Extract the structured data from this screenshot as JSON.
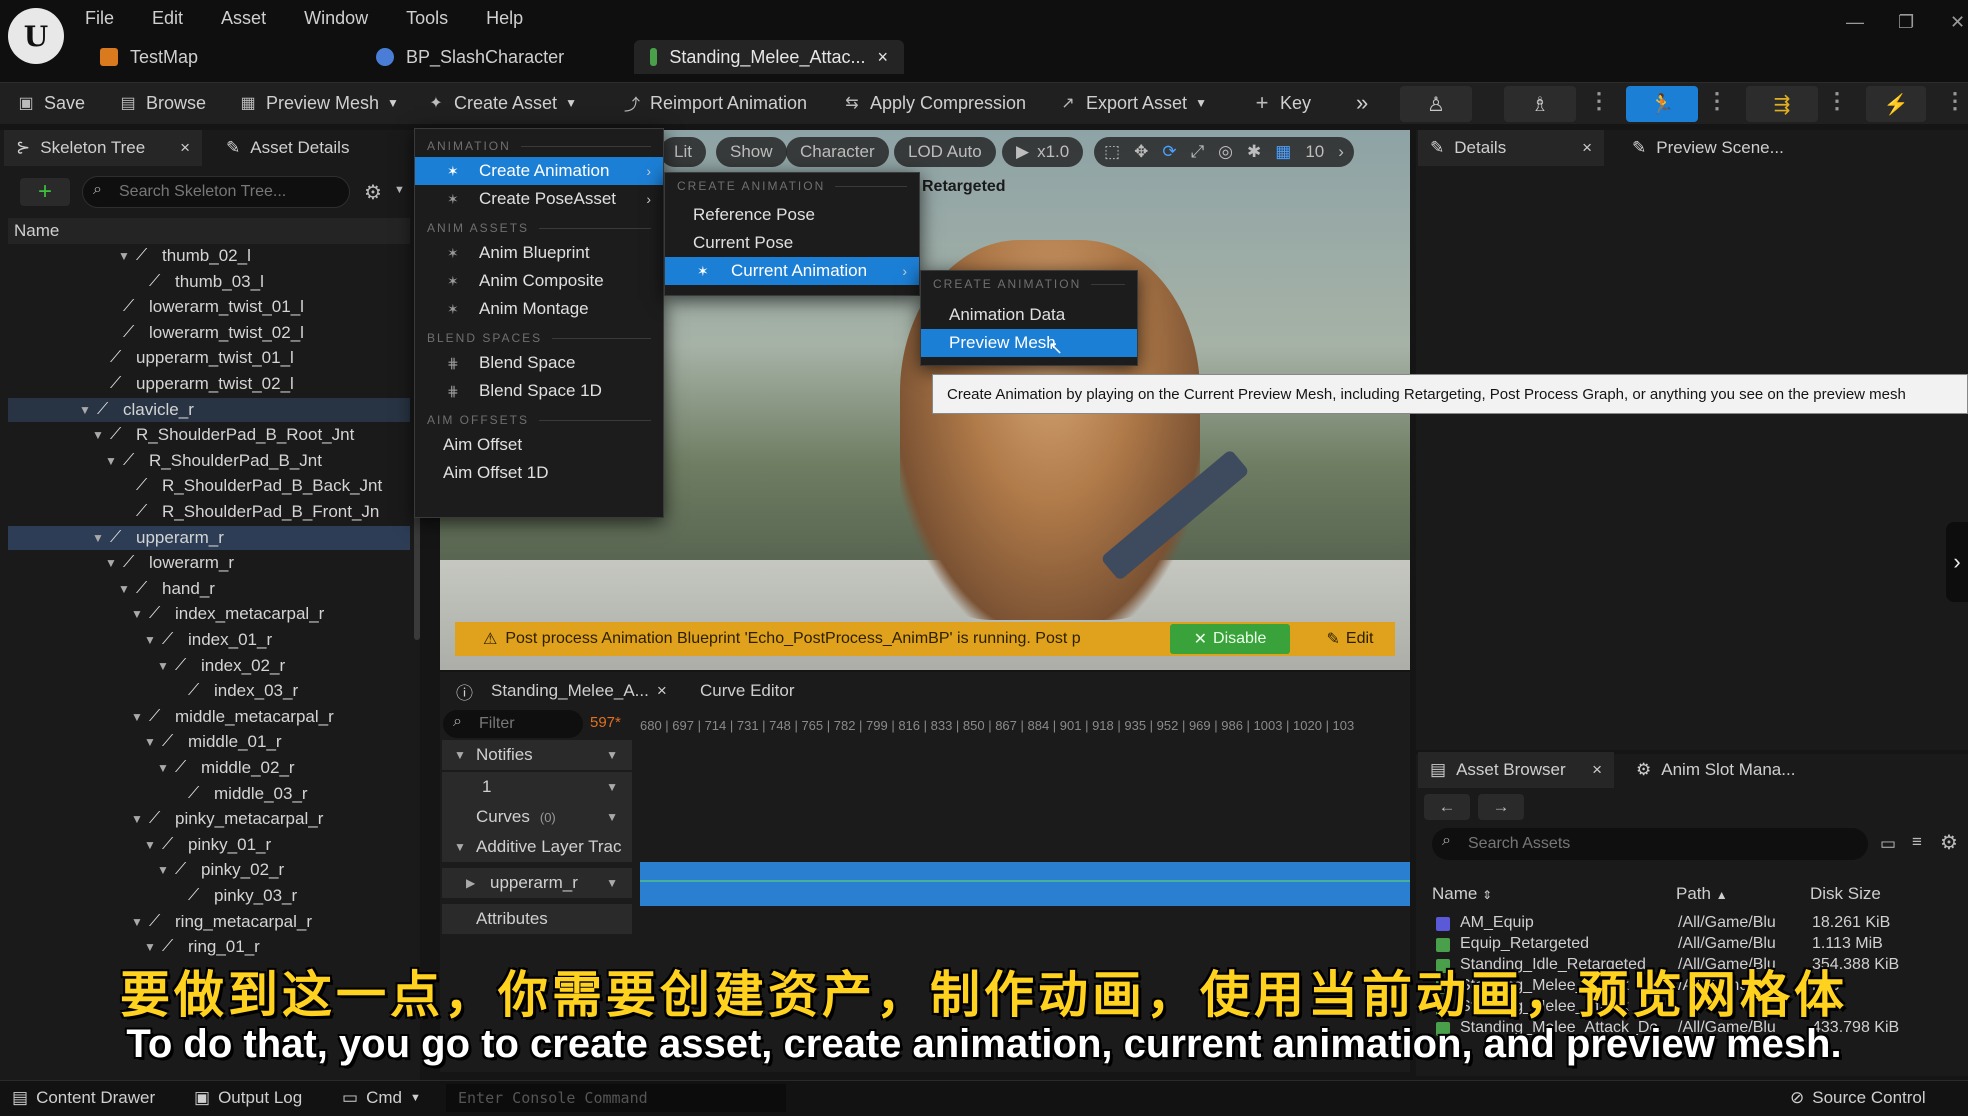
{
  "menubar": [
    "File",
    "Edit",
    "Asset",
    "Window",
    "Tools",
    "Help"
  ],
  "doc_tabs": [
    {
      "label": "TestMap"
    },
    {
      "label": "BP_SlashCharacter"
    },
    {
      "label": "Standing_Melee_Attac...",
      "close": "×"
    }
  ],
  "toolbar": {
    "save": "Save",
    "browse": "Browse",
    "preview_mesh": "Preview Mesh",
    "create_asset": "Create Asset",
    "reimport": "Reimport Animation",
    "apply_compression": "Apply Compression",
    "export_asset": "Export Asset",
    "key": "Key"
  },
  "left_panel": {
    "tabs": [
      "Skeleton Tree",
      "Asset Details"
    ],
    "search_placeholder": "Search Skeleton Tree...",
    "name_header": "Name",
    "bones": [
      {
        "label": "thumb_02_l",
        "depth": 6,
        "twist": "▼"
      },
      {
        "label": "thumb_03_l",
        "depth": 7,
        "twist": ""
      },
      {
        "label": "lowerarm_twist_01_l",
        "depth": 5,
        "twist": ""
      },
      {
        "label": "lowerarm_twist_02_l",
        "depth": 5,
        "twist": ""
      },
      {
        "label": "upperarm_twist_01_l",
        "depth": 4,
        "twist": ""
      },
      {
        "label": "upperarm_twist_02_l",
        "depth": 4,
        "twist": ""
      },
      {
        "label": "clavicle_r",
        "depth": 3,
        "twist": "▼",
        "state": "hover"
      },
      {
        "label": "R_ShoulderPad_B_Root_Jnt",
        "depth": 4,
        "twist": "▼"
      },
      {
        "label": "R_ShoulderPad_B_Jnt",
        "depth": 5,
        "twist": "▼"
      },
      {
        "label": "R_ShoulderPad_B_Back_Jnt",
        "depth": 6,
        "twist": ""
      },
      {
        "label": "R_ShoulderPad_B_Front_Jn",
        "depth": 6,
        "twist": ""
      },
      {
        "label": "upperarm_r",
        "depth": 4,
        "twist": "▼",
        "state": "selected"
      },
      {
        "label": "lowerarm_r",
        "depth": 5,
        "twist": "▼"
      },
      {
        "label": "hand_r",
        "depth": 6,
        "twist": "▼"
      },
      {
        "label": "index_metacarpal_r",
        "depth": 7,
        "twist": "▼"
      },
      {
        "label": "index_01_r",
        "depth": 8,
        "twist": "▼"
      },
      {
        "label": "index_02_r",
        "depth": 9,
        "twist": "▼"
      },
      {
        "label": "index_03_r",
        "depth": 10,
        "twist": ""
      },
      {
        "label": "middle_metacarpal_r",
        "depth": 7,
        "twist": "▼"
      },
      {
        "label": "middle_01_r",
        "depth": 8,
        "twist": "▼"
      },
      {
        "label": "middle_02_r",
        "depth": 9,
        "twist": "▼"
      },
      {
        "label": "middle_03_r",
        "depth": 10,
        "twist": ""
      },
      {
        "label": "pinky_metacarpal_r",
        "depth": 7,
        "twist": "▼"
      },
      {
        "label": "pinky_01_r",
        "depth": 8,
        "twist": "▼"
      },
      {
        "label": "pinky_02_r",
        "depth": 9,
        "twist": "▼"
      },
      {
        "label": "pinky_03_r",
        "depth": 10,
        "twist": ""
      },
      {
        "label": "ring_metacarpal_r",
        "depth": 7,
        "twist": "▼"
      },
      {
        "label": "ring_01_r",
        "depth": 8,
        "twist": "▼"
      }
    ]
  },
  "viewport": {
    "lit": "Lit",
    "show": "Show",
    "character": "Character",
    "lod": "LOD Auto",
    "speed": "x1.0",
    "grid_value": "10",
    "retargeted_label": "Retargeted",
    "warning": "Post process Animation Blueprint 'Echo_PostProcess_AnimBP' is running. Post p",
    "disable": "Disable",
    "edit": "Edit"
  },
  "create_asset_menu": {
    "sections": {
      "animation": "ANIMATION",
      "anim_assets": "ANIM ASSETS",
      "blend_spaces": "BLEND SPACES",
      "aim_offsets": "AIM OFFSETS"
    },
    "create_animation": "Create Animation",
    "create_pose_asset": "Create PoseAsset",
    "anim_blueprint": "Anim Blueprint",
    "anim_composite": "Anim Composite",
    "anim_montage": "Anim Montage",
    "blend_space": "Blend Space",
    "blend_space_1d": "Blend Space 1D",
    "aim_offset": "Aim Offset",
    "aim_offset_1d": "Aim Offset 1D"
  },
  "create_animation_menu": {
    "section": "CREATE ANIMATION",
    "reference_pose": "Reference Pose",
    "current_pose": "Current Pose",
    "current_animation": "Current Animation"
  },
  "current_animation_menu": {
    "section": "CREATE ANIMATION",
    "animation_data": "Animation Data",
    "preview_mesh": "Preview Mesh"
  },
  "tooltip": "Create Animation by playing on the Current Preview Mesh, including Retargeting, Post Process Graph, or anything you see on the preview mesh",
  "timeline": {
    "tab_asset": "Standing_Melee_A...",
    "tab_close": "×",
    "tab_curve": "Curve Editor",
    "filter_placeholder": "Filter",
    "frame": "597*",
    "ruler": "680 | 697 | 714 | 731 | 748 | 765 | 782 | 799 | 816 | 833 | 850 | 867 | 884 | 901 | 918 | 935 | 952 | 969 | 986 | 1003 | 1020 | 103",
    "notifies": "Notifies",
    "notify_track": "1",
    "curves": "Curves",
    "curves_count": "(0)",
    "additive": "Additive Layer Trac",
    "upperarm": "upperarm_r",
    "attributes": "Attributes"
  },
  "details": {
    "tab": "Details",
    "preview_scene": "Preview Scene..."
  },
  "asset_browser": {
    "tab": "Asset Browser",
    "anim_slot": "Anim Slot Mana...",
    "search_placeholder": "Search Assets",
    "col_name": "Name",
    "col_path": "Path",
    "col_size": "Disk Size",
    "rows": [
      {
        "name": "AM_Equip",
        "path": "/All/Game/Blu",
        "size": "18.261 KiB",
        "color": "#5a5ad8"
      },
      {
        "name": "Equip_Retargeted",
        "path": "/All/Game/Blu",
        "size": "1.113 MiB",
        "color": "#4aa04a"
      },
      {
        "name": "Standing_Idle_Retargeted",
        "path": "/All/Game/Blu",
        "size": "354.388 KiB",
        "color": "#4aa04a"
      },
      {
        "name": "Standing_Melee_Attack",
        "path": "/All/Game/Blu",
        "size": "MiB",
        "color": "#4aa04a"
      },
      {
        "name": "Standing_Melee_Attack",
        "path": "",
        "size": "",
        "color": "#4aa04a"
      },
      {
        "name": "Standing_Melee_Attack_Dc",
        "path": "/All/Game/Blu",
        "size": "433.798 KiB",
        "color": "#4aa04a"
      }
    ]
  },
  "subtitles": {
    "cn": "要做到这一点，你需要创建资产，制作动画，使用当前动画，预览网格体",
    "en": "To do that, you go to create asset, create animation, current animation, and preview mesh."
  },
  "statusbar": {
    "content_drawer": "Content Drawer",
    "output_log": "Output Log",
    "cmd": "Cmd",
    "console_placeholder": "Enter Console Command",
    "source_control": "Source Control"
  }
}
